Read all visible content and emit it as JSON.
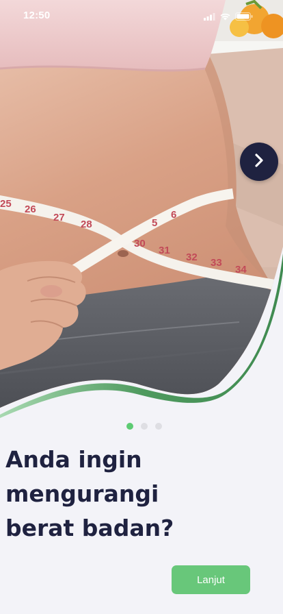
{
  "status_bar": {
    "time": "12:50",
    "icons": [
      "signal-icon",
      "wifi-icon",
      "battery-icon"
    ]
  },
  "hero": {
    "image": "waist-measuring-tape-photo",
    "tape_numbers": [
      "25",
      "26",
      "27",
      "28",
      "5",
      "6",
      "30",
      "31",
      "32",
      "33",
      "34"
    ],
    "next_icon": "chevron-right-icon"
  },
  "pagination": {
    "total": 3,
    "active_index": 0
  },
  "onboarding": {
    "title_line1": "Anda ingin mengurangi",
    "title_line2": "berat badan?"
  },
  "actions": {
    "continue_label": "Lanjut"
  },
  "colors": {
    "background": "#f3f3f8",
    "primary_dark": "#1f2240",
    "accent_green": "#68c77a",
    "active_dot": "#5dcb73",
    "inactive_dot": "#dedee3"
  }
}
